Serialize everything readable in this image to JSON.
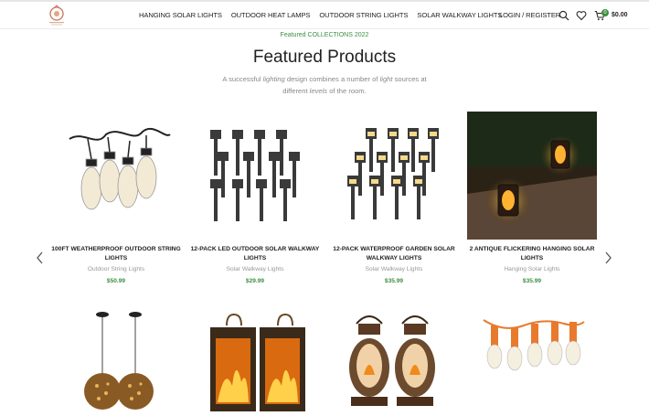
{
  "nav": {
    "items": [
      "HANGING SOLAR LIGHTS",
      "OUTDOOR HEAT LAMPS",
      "OUTDOOR STRING LIGHTS",
      "SOLAR WALKWAY LIGHTS"
    ],
    "login": "LOGIN / REGISTER",
    "cart_count": "0",
    "cart_total": "$0.00"
  },
  "section": {
    "eyebrow": "Featured COLLECTIONS 2022",
    "title": "Featured Products",
    "subtitle_parts": [
      "A successful ",
      "lighting",
      " design combines a number of ",
      "light",
      " sources at different ",
      "levels",
      " of the room."
    ]
  },
  "products": [
    {
      "name": "100FT WEATHERPROOF OUTDOOR STRING LIGHTS",
      "category": "Outdoor String Lights",
      "price": "$50.99",
      "icon": "string-lights-image"
    },
    {
      "name": "12-PACK LED OUTDOOR SOLAR WALKWAY LIGHTS",
      "category": "Solar Walkway Lights",
      "price": "$29.99",
      "icon": "walkway-lights-image"
    },
    {
      "name": "12-PACK WATERPROOF GARDEN SOLAR WALKWAY LIGHTS",
      "category": "Solar Walkway Lights",
      "price": "$35.99",
      "icon": "garden-lights-image"
    },
    {
      "name": "2 ANTIQUE FLICKERING HANGING SOLAR LIGHTS",
      "category": "Hanging Solar Lights",
      "price": "$35.99",
      "icon": "lantern-photo-image"
    },
    {
      "name": "",
      "category": "",
      "price": "",
      "icon": "globe-pendant-image"
    },
    {
      "name": "",
      "category": "",
      "price": "",
      "icon": "flame-lantern-image"
    },
    {
      "name": "",
      "category": "",
      "price": "",
      "icon": "oil-lantern-image"
    },
    {
      "name": "",
      "category": "",
      "price": "",
      "icon": "orange-string-lights-image"
    }
  ],
  "colors": {
    "accent": "#3e8e41",
    "text": "#222222",
    "muted": "#999999"
  }
}
